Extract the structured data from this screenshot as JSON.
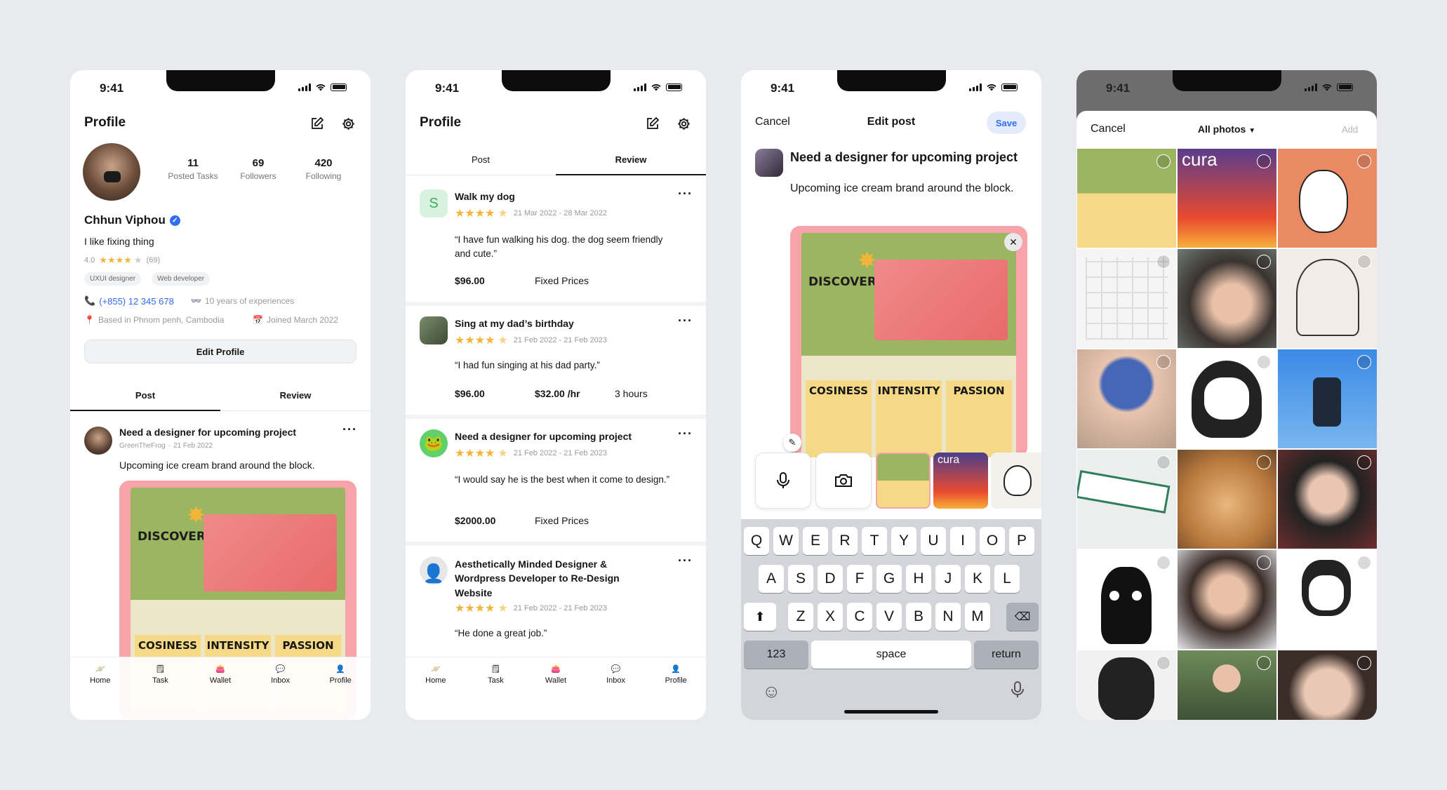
{
  "status": {
    "time": "9:41"
  },
  "profile": {
    "title": "Profile",
    "stats": [
      {
        "value": "11",
        "label": "Posted Tasks"
      },
      {
        "value": "69",
        "label": "Followers"
      },
      {
        "value": "420",
        "label": "Following"
      }
    ],
    "name": "Chhun Viphou",
    "bio": "I like fixing thing",
    "rating": "4.0",
    "rating_count": "(69)",
    "tags": [
      "UXUI designer",
      "Web developer"
    ],
    "phone": "(+855) 12 345 678",
    "experience": "10 years of experiences",
    "location": "Based in Phnom penh, Cambodia",
    "joined": "Joined March 2022",
    "edit_label": "Edit Profile",
    "tabs": [
      "Post",
      "Review"
    ],
    "post": {
      "title": "Need a designer for upcoming project",
      "author": "GreenTheFrog",
      "date": "21 Feb 2022",
      "body": "Upcoming ice cream brand around the block."
    }
  },
  "mockup": {
    "headline": "DISCOVER NEW TASTES",
    "products": [
      "COSINESS",
      "INTENSITY",
      "PASSION"
    ]
  },
  "nav": [
    "Home",
    "Task",
    "Wallet",
    "Inbox",
    "Profile"
  ],
  "reviews": [
    {
      "initial": "S",
      "title": "Walk my dog",
      "dates": "21 Mar 2022 - 28 Mar 2022",
      "quote": "“I have fun walking his dog. the dog seem friendly and cute.”",
      "price": "$96.00",
      "type": "Fixed Prices"
    },
    {
      "title": "Sing at my dad’s birthday",
      "dates": "21 Feb 2022 - 21 Feb 2023",
      "quote": "“I had fun singing at his dad party.”",
      "price": "$96.00",
      "rate": "$32.00 /hr",
      "hours": "3 hours"
    },
    {
      "title": "Need a designer for upcoming project",
      "dates": "21 Feb 2022 - 21 Feb 2023",
      "quote": "“I would say he is the best when it come to design.”",
      "price": "$2000.00",
      "type": "Fixed Prices"
    },
    {
      "title": "Aesthetically Minded Designer & Wordpress Developer to Re-Design Website",
      "dates": "21 Feb 2022 - 21 Feb 2023",
      "quote": "“He done a great job.”"
    }
  ],
  "edit_post": {
    "cancel": "Cancel",
    "title": "Edit post",
    "save": "Save",
    "post_title": "Need a designer for upcoming project",
    "body": "Upcoming ice cream brand around the block."
  },
  "keyboard": {
    "row1": [
      "Q",
      "W",
      "E",
      "R",
      "T",
      "Y",
      "U",
      "I",
      "O",
      "P"
    ],
    "row2": [
      "A",
      "S",
      "D",
      "F",
      "G",
      "H",
      "J",
      "K",
      "L"
    ],
    "row3": [
      "Z",
      "X",
      "C",
      "V",
      "B",
      "N",
      "M"
    ],
    "numbers": "123",
    "space": "space",
    "return": "return"
  },
  "picker": {
    "cancel": "Cancel",
    "album": "All photos",
    "add": "Add",
    "thumb_text": "cura"
  }
}
